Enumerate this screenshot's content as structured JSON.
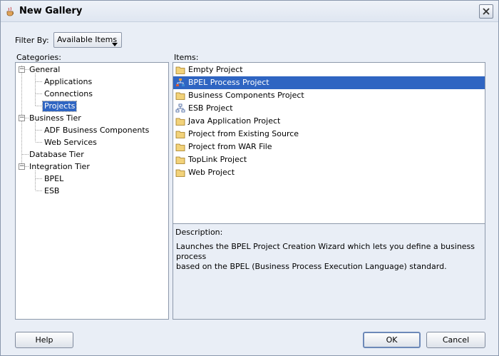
{
  "window": {
    "title": "New Gallery",
    "close_label": "close"
  },
  "filter": {
    "label": "Filter By:",
    "selected": "Available Items"
  },
  "categories": {
    "label": "Categories:",
    "nodes": [
      {
        "label": "General",
        "expanded": true
      },
      {
        "label": "Applications"
      },
      {
        "label": "Connections"
      },
      {
        "label": "Projects",
        "selected": true
      },
      {
        "label": "Business Tier",
        "expanded": true
      },
      {
        "label": "ADF Business Components"
      },
      {
        "label": "Web Services"
      },
      {
        "label": "Database Tier"
      },
      {
        "label": "Integration Tier",
        "expanded": true
      },
      {
        "label": "BPEL"
      },
      {
        "label": "ESB"
      }
    ]
  },
  "items": {
    "label": "Items:",
    "list": [
      {
        "label": "Empty Project",
        "icon": "folder-icon"
      },
      {
        "label": "BPEL Process Project",
        "icon": "bpel-icon",
        "selected": true
      },
      {
        "label": "Business Components Project",
        "icon": "folder-icon"
      },
      {
        "label": "ESB Project",
        "icon": "esb-icon"
      },
      {
        "label": "Java Application Project",
        "icon": "folder-icon"
      },
      {
        "label": "Project from Existing Source",
        "icon": "folder-icon"
      },
      {
        "label": "Project from WAR File",
        "icon": "folder-icon"
      },
      {
        "label": "TopLink Project",
        "icon": "folder-icon"
      },
      {
        "label": "Web Project",
        "icon": "folder-icon"
      }
    ]
  },
  "description": {
    "label": "Description:",
    "text_line1": "Launches the BPEL Project Creation Wizard which lets you define a business process",
    "text_line2": "based on the BPEL (Business Process Execution Language) standard."
  },
  "buttons": {
    "help": "Help",
    "ok": "OK",
    "cancel": "Cancel"
  },
  "colors": {
    "selection": "#2f65c2",
    "background": "#e9eef6",
    "border": "#8d99ab"
  }
}
